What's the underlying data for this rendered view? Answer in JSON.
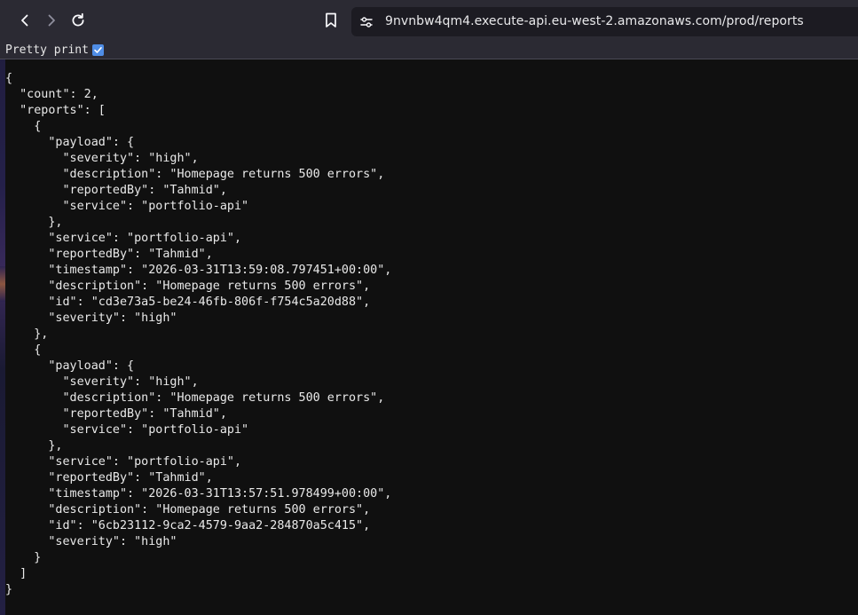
{
  "browser": {
    "url": "9nvnbw4qm4.execute-api.eu-west-2.amazonaws.com/prod/reports",
    "icons": {
      "back": "arrow-left-icon",
      "forward": "arrow-right-icon",
      "reload": "reload-icon",
      "bookmark": "bookmark-icon",
      "site_info": "tune-icon"
    },
    "colors": {
      "toolbar": "#2b2a33",
      "urlbar": "#1c1b22",
      "checkbox": "#4f8de6",
      "page_background": "#101010"
    }
  },
  "json_viewer": {
    "pretty_print_label": "Pretty print",
    "pretty_print_checked": true,
    "lines": [
      "{",
      "  \"count\": 2,",
      "  \"reports\": [",
      "    {",
      "      \"payload\": {",
      "        \"severity\": \"high\",",
      "        \"description\": \"Homepage returns 500 errors\",",
      "        \"reportedBy\": \"Tahmid\",",
      "        \"service\": \"portfolio-api\"",
      "      },",
      "      \"service\": \"portfolio-api\",",
      "      \"reportedBy\": \"Tahmid\",",
      "      \"timestamp\": \"2026-03-31T13:59:08.797451+00:00\",",
      "      \"description\": \"Homepage returns 500 errors\",",
      "      \"id\": \"cd3e73a5-be24-46fb-806f-f754c5a20d88\",",
      "      \"severity\": \"high\"",
      "    },",
      "    {",
      "      \"payload\": {",
      "        \"severity\": \"high\",",
      "        \"description\": \"Homepage returns 500 errors\",",
      "        \"reportedBy\": \"Tahmid\",",
      "        \"service\": \"portfolio-api\"",
      "      },",
      "      \"service\": \"portfolio-api\",",
      "      \"reportedBy\": \"Tahmid\",",
      "      \"timestamp\": \"2026-03-31T13:57:51.978499+00:00\",",
      "      \"description\": \"Homepage returns 500 errors\",",
      "      \"id\": \"6cb23112-9ca2-4579-9aa2-284870a5c415\",",
      "      \"severity\": \"high\"",
      "    }",
      "  ]",
      "}"
    ]
  }
}
